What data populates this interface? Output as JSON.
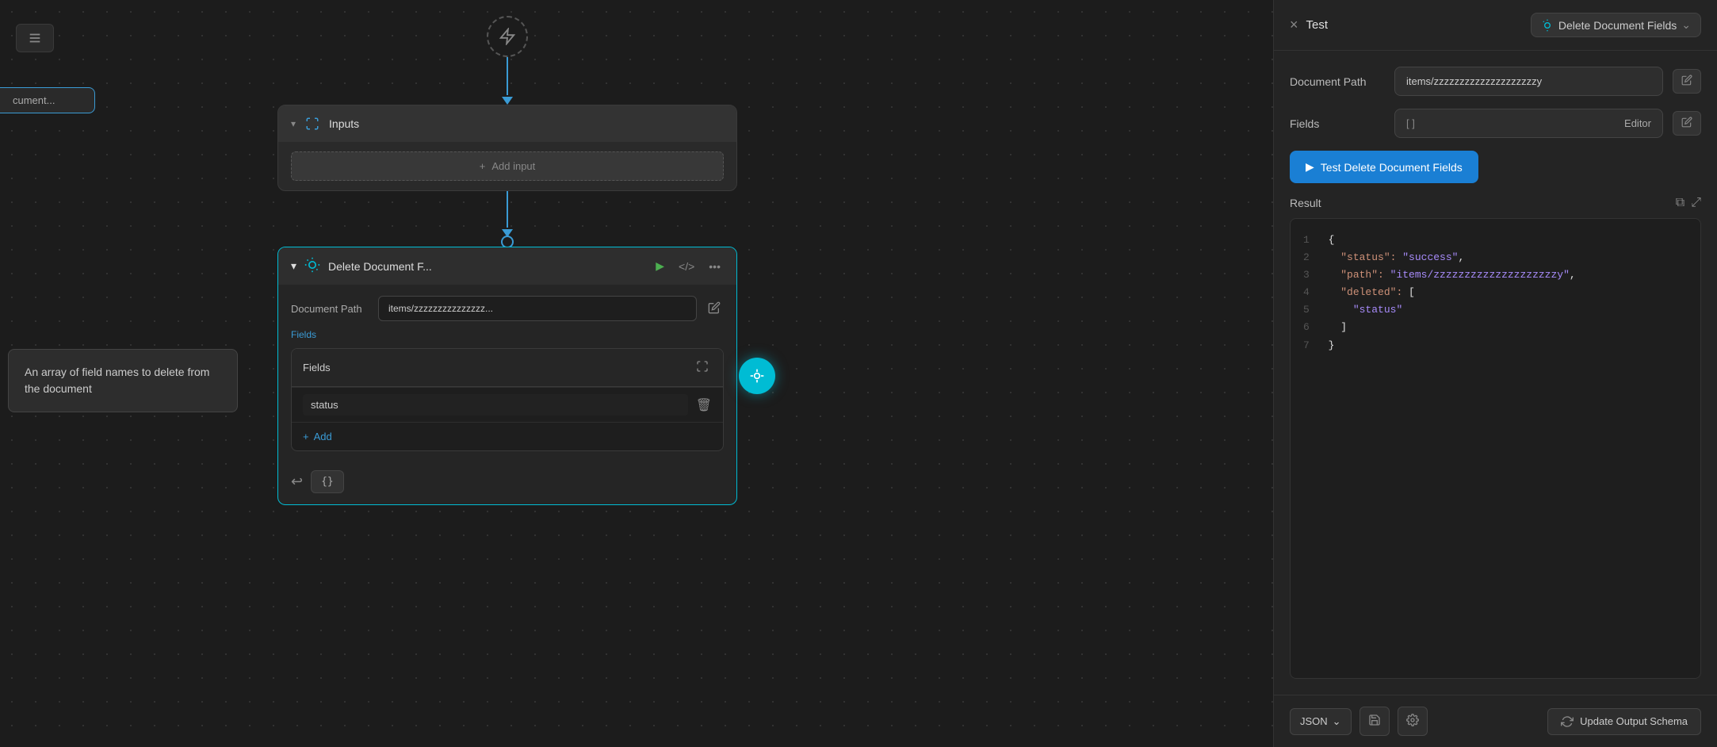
{
  "canvas": {
    "doc_card_label": "cument...",
    "trigger_title": "trigger",
    "inputs_node": {
      "title": "Inputs",
      "add_input_label": "Add input"
    },
    "delete_node": {
      "title": "Delete Document F...",
      "document_path_label": "Document Path",
      "document_path_value": "items/zzzzzzzzzzzzzzz...",
      "fields_label": "Fields",
      "fields_header": "Fields",
      "field_items": [
        {
          "value": "status"
        }
      ],
      "add_label": "Add",
      "code_btn_label": "{}"
    },
    "tooltip": {
      "text": "An array of field names to delete from the document"
    }
  },
  "panel": {
    "close_label": "×",
    "title": "Test",
    "action_title": "Delete Document Fields",
    "chevron": "⌄",
    "document_path_label": "Document Path",
    "document_path_value": "items/zzzzzzzzzzzzzzzzzzzzy",
    "fields_label": "Fields",
    "fields_bracket": "[ ]",
    "fields_editor": "Editor",
    "test_btn_label": "Test Delete Document Fields",
    "result_title": "Result",
    "copy_icon": "⧉",
    "expand_icon": "⤢",
    "result_lines": [
      {
        "num": 1,
        "content": "{",
        "type": "brace"
      },
      {
        "num": 2,
        "content": "  \"status\": \"success\",",
        "type": "key-string"
      },
      {
        "num": 3,
        "content": "  \"path\": \"items/zzzzzzzzzzzzzzzzzzzzy\",",
        "type": "key-string"
      },
      {
        "num": 4,
        "content": "  \"deleted\": [",
        "type": "key-array"
      },
      {
        "num": 5,
        "content": "    \"status\"",
        "type": "string-val"
      },
      {
        "num": 6,
        "content": "  ]",
        "type": "brace"
      },
      {
        "num": 7,
        "content": "}",
        "type": "brace"
      }
    ],
    "footer": {
      "json_label": "JSON",
      "update_schema_label": "Update Output Schema"
    }
  }
}
